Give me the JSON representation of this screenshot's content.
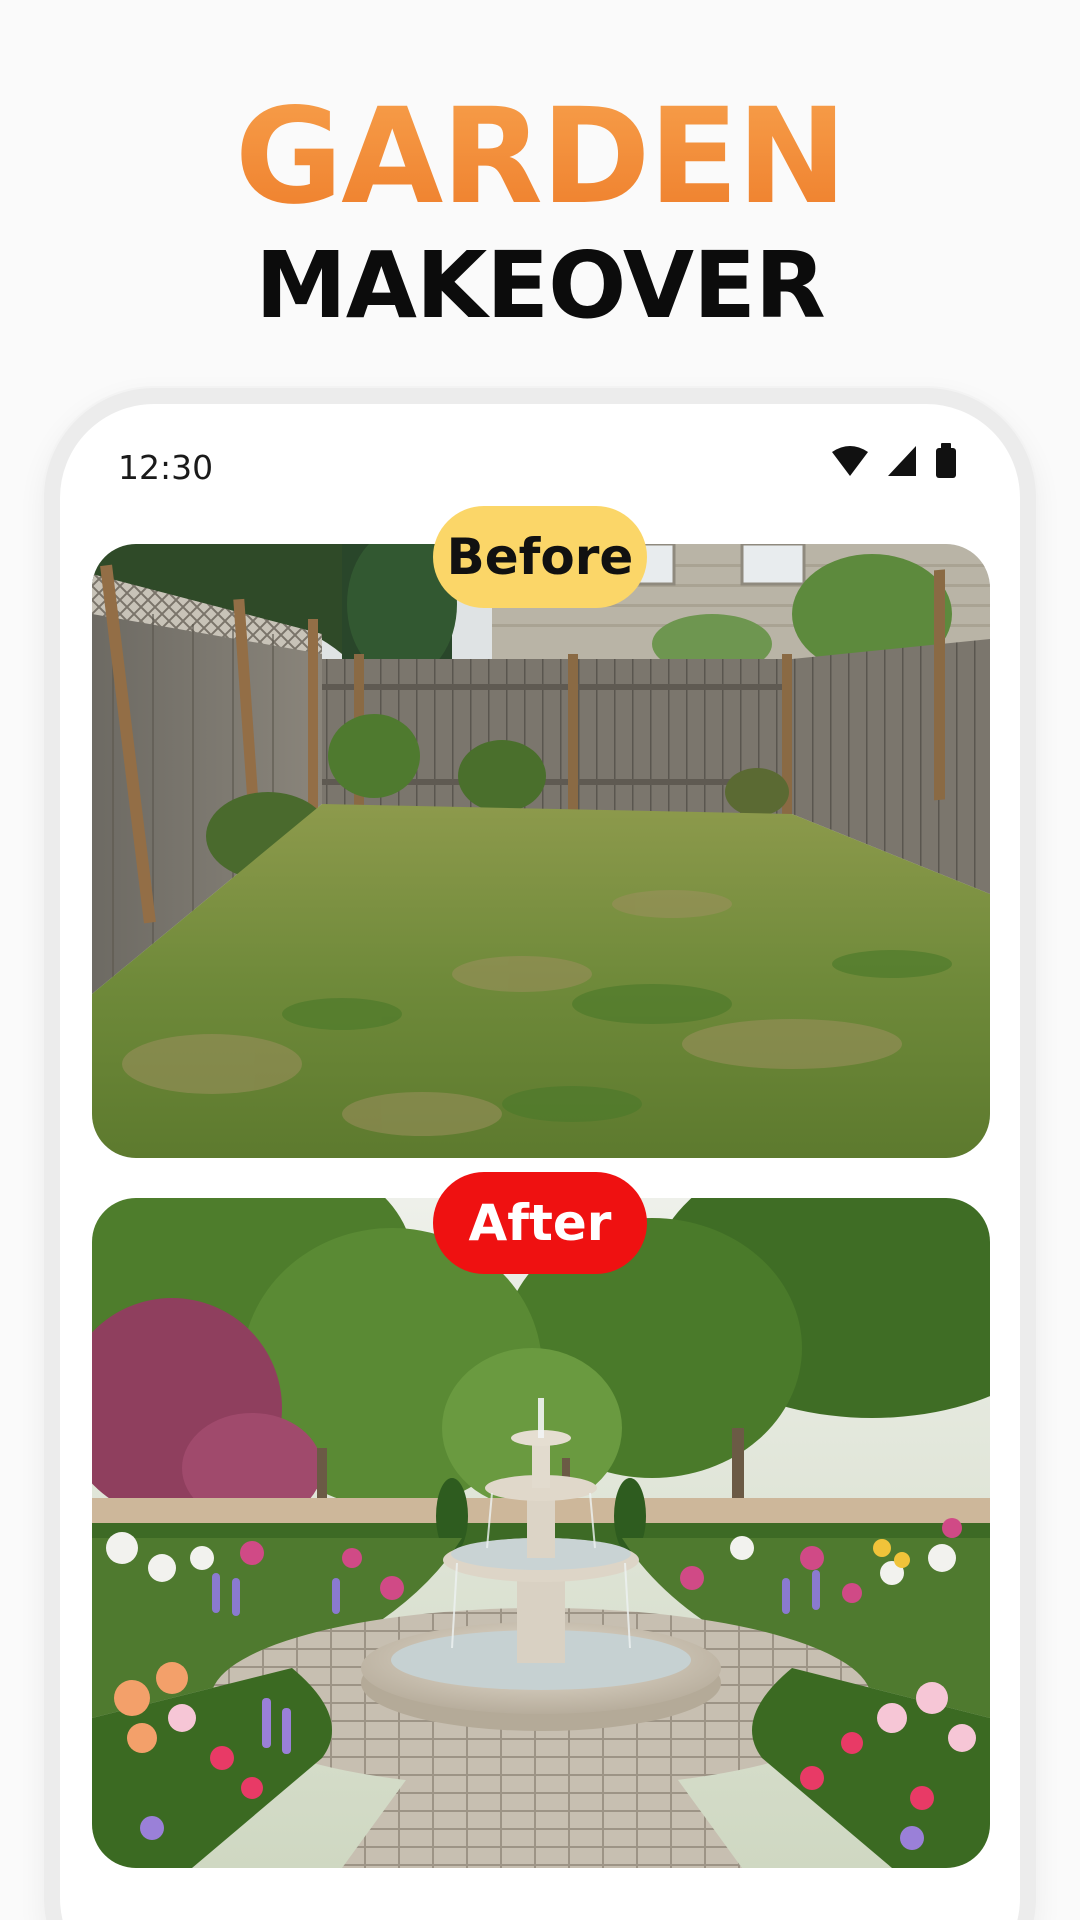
{
  "headline": {
    "line1": "GARDEN",
    "line2": "MAKEOVER"
  },
  "status_bar": {
    "time": "12:30",
    "icons": [
      "wifi-icon",
      "signal-icon",
      "battery-icon"
    ]
  },
  "comparison": {
    "before_label": "Before",
    "after_label": "After"
  },
  "colors": {
    "accent_orange": "#f28a3a",
    "before_badge": "#fbd668",
    "after_badge": "#ef1111"
  }
}
